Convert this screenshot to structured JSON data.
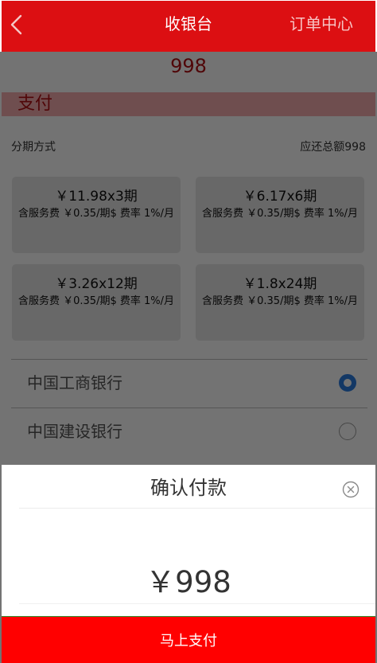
{
  "header": {
    "title": "收银台",
    "order_center": "订单中心"
  },
  "total_amount": "998",
  "pay_section": {
    "label": "支付"
  },
  "installment": {
    "method_label": "分期方式",
    "total_label": "应还总额998",
    "plans": [
      {
        "main": "￥11.98x3期",
        "sub": "含服务费 ￥0.35/期$ 费率 1%/月"
      },
      {
        "main": "￥6.17x6期",
        "sub": "含服务费 ￥0.35/期$ 费率 1%/月"
      },
      {
        "main": "￥3.26x12期",
        "sub": "含服务费 ￥0.35/期$ 费率 1%/月"
      },
      {
        "main": "￥1.8x24期",
        "sub": "含服务费 ￥0.35/期$ 费率 1%/月"
      }
    ]
  },
  "banks": [
    {
      "name": "中国工商银行",
      "selected": true
    },
    {
      "name": "中国建设银行",
      "selected": false
    }
  ],
  "modal": {
    "title": "确认付款",
    "amount": "￥998",
    "pay_button": "马上支付"
  },
  "colors": {
    "brand_red": "#dc0f12",
    "pay_button": "#ff0000",
    "radio_selected": "#2a7de1"
  },
  "icons": {
    "back": "chevron-left-icon",
    "close": "close-circle-icon",
    "radio": "radio-icon"
  }
}
